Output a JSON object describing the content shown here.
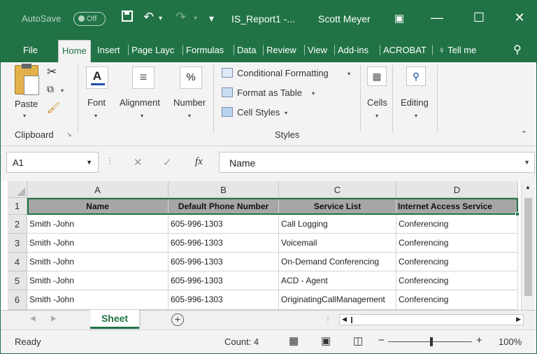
{
  "titlebar": {
    "autosave_label": "AutoSave",
    "autosave_state": "Off",
    "filename": "IS_Report1 -...",
    "user": "Scott Meyer"
  },
  "tabs": [
    "File",
    "Home",
    "Insert",
    "Page Layc",
    "Formulas",
    "Data",
    "Review",
    "View",
    "Add-ins",
    "ACROBAT",
    "Tell me"
  ],
  "ribbon": {
    "paste": "Paste",
    "clipboard": "Clipboard",
    "font": "Font",
    "alignment": "Alignment",
    "number": "Number",
    "number_symbol": "%",
    "conditional_formatting": "Conditional Formatting",
    "format_as_table": "Format as Table",
    "cell_styles": "Cell Styles",
    "styles": "Styles",
    "cells": "Cells",
    "editing": "Editing"
  },
  "formula_bar": {
    "name_box": "A1",
    "fx": "fx",
    "content": "Name"
  },
  "grid": {
    "columns": [
      "A",
      "B",
      "C",
      "D"
    ],
    "rows": [
      "1",
      "2",
      "3",
      "4",
      "5",
      "6"
    ],
    "headers": [
      "Name",
      "Default Phone Number",
      "Service List",
      "Internet Access Service"
    ],
    "data": [
      [
        "Smith -John",
        "605-996-1303",
        "Call Logging",
        "Conferencing"
      ],
      [
        "Smith -John",
        "605-996-1303",
        "Voicemail",
        "Conferencing"
      ],
      [
        "Smith -John",
        "605-996-1303",
        "On-Demand Conferencing",
        "Conferencing"
      ],
      [
        "Smith -John",
        "605-996-1303",
        "ACD - Agent",
        "Conferencing"
      ],
      [
        "Smith -John",
        "605-996-1303",
        "OriginatingCallManagement",
        "Conferencing"
      ]
    ]
  },
  "sheet_tab": "Sheet",
  "status": {
    "ready": "Ready",
    "count": "Count: 4",
    "zoom": "100%"
  },
  "colors": {
    "accent": "#217346",
    "header_fill": "#a6a6a6"
  }
}
